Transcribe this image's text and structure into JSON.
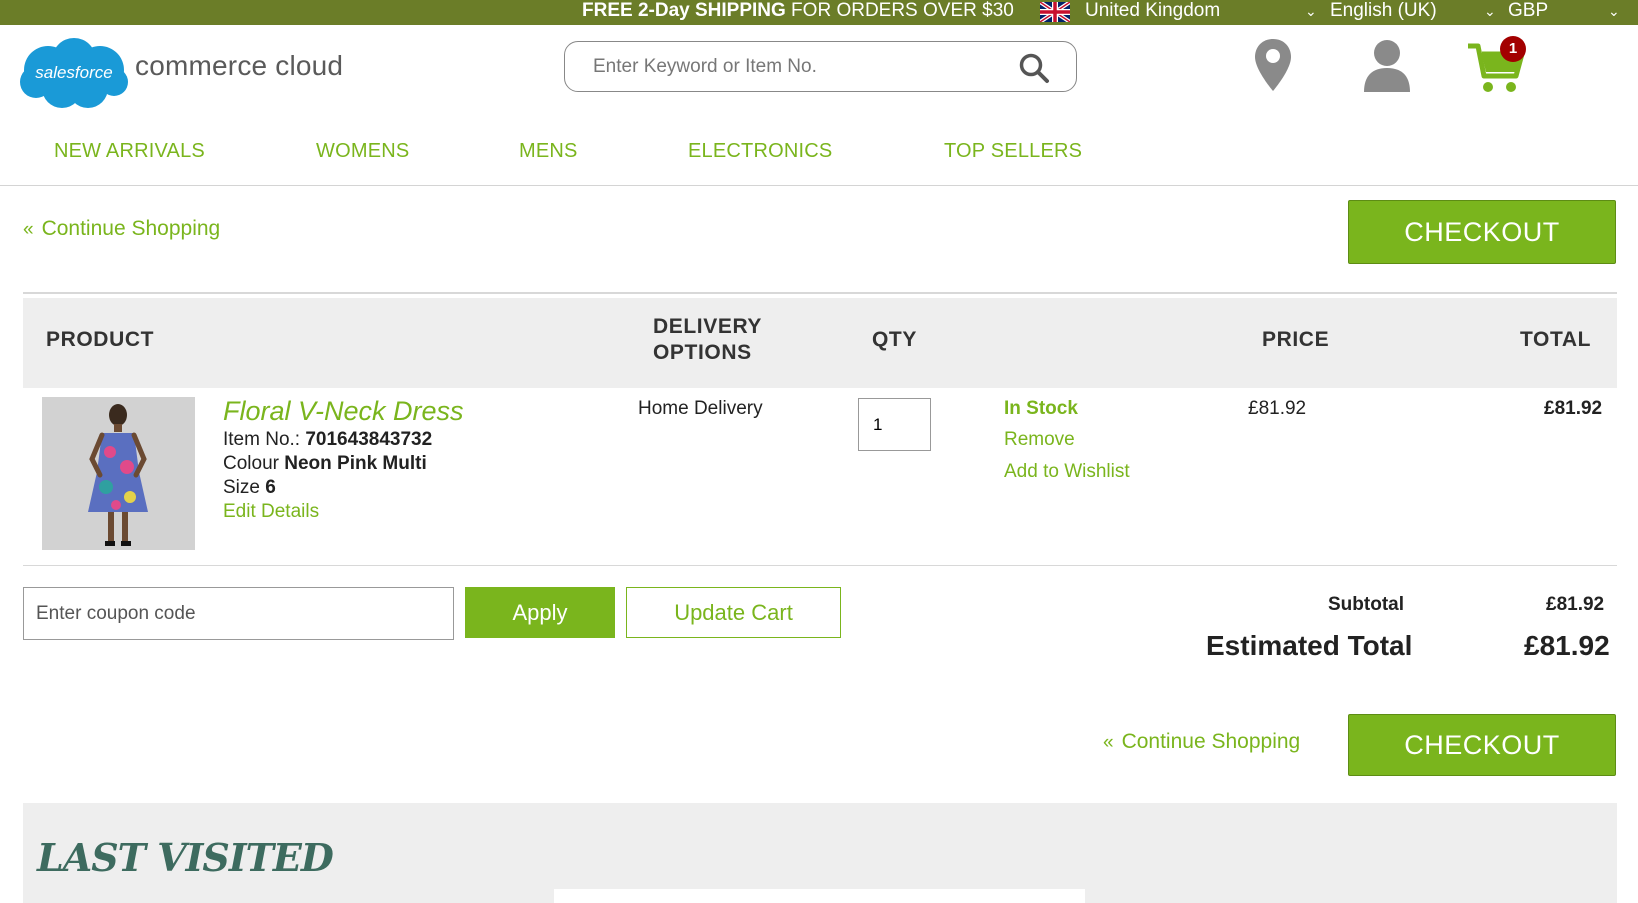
{
  "topbar": {
    "promo_bold1": "FREE 2-Day SHIPPING",
    "promo_rest": " FOR ORDERS OVER $30",
    "country": "United Kingdom",
    "language": "English (UK)",
    "currency": "GBP"
  },
  "header": {
    "logo_badge": "salesforce",
    "logo_text": "commerce cloud",
    "search_placeholder": "Enter Keyword or Item No.",
    "cart_count": "1"
  },
  "nav": {
    "items": [
      {
        "label": "NEW ARRIVALS"
      },
      {
        "label": "WOMENS"
      },
      {
        "label": "MENS"
      },
      {
        "label": "ELECTRONICS"
      },
      {
        "label": "TOP SELLERS"
      }
    ]
  },
  "cart": {
    "continue_label": "Continue Shopping",
    "checkout_label": "CHECKOUT",
    "columns": {
      "product": "PRODUCT",
      "delivery_line1": "DELIVERY",
      "delivery_line2": "OPTIONS",
      "qty": "QTY",
      "price": "PRICE",
      "total": "TOTAL"
    },
    "item": {
      "name": "Floral V-Neck Dress",
      "item_no_label": "Item No.: ",
      "item_no": "701643843732",
      "colour_label": "Colour ",
      "colour": "Neon Pink Multi",
      "size_label": "Size ",
      "size": "6",
      "edit_label": "Edit Details",
      "delivery": "Home Delivery",
      "qty": "1",
      "stock": "In Stock",
      "remove_label": "Remove",
      "wishlist_label": "Add to Wishlist",
      "price": "£81.92",
      "total": "£81.92"
    },
    "coupon_placeholder": "Enter coupon code",
    "apply_label": "Apply",
    "update_label": "Update Cart",
    "subtotal_label": "Subtotal",
    "subtotal_value": "£81.92",
    "estimated_label": "Estimated Total",
    "estimated_value": "£81.92"
  },
  "last_visited": {
    "title": "LAST VISITED"
  },
  "colors": {
    "accent": "#7ab51d",
    "topbar": "#6b7d28",
    "cart_badge": "#a30000",
    "logo_blue": "#1a9ad7",
    "heading_teal": "#3d6b5f"
  }
}
